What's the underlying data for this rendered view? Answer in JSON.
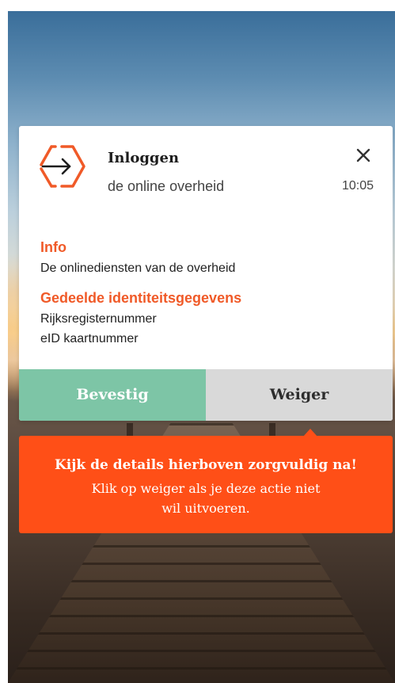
{
  "notification": {
    "title": "Inloggen",
    "subtitle": "de online overheid",
    "time": "10:05",
    "close_icon": "close-icon",
    "logo_icon": "login-arrow-hexagon-icon",
    "accent_color": "#f05a28"
  },
  "details": {
    "info_heading": "Info",
    "info_text": "De onlinediensten van de overheid",
    "shared_heading": "Gedeelde identiteitsgegevens",
    "shared_items": [
      "Rijksregisternummer",
      "eID kaartnummer"
    ]
  },
  "actions": {
    "confirm_label": "Bevestig",
    "reject_label": "Weiger",
    "confirm_color": "#7dc5a6",
    "reject_color": "#d9d9d9"
  },
  "warning": {
    "title": "Kijk de details hierboven zorgvuldig na!",
    "line1": "Klik op weiger als je deze actie niet",
    "line2": "wil uitvoeren.",
    "color": "#ff4f17"
  }
}
